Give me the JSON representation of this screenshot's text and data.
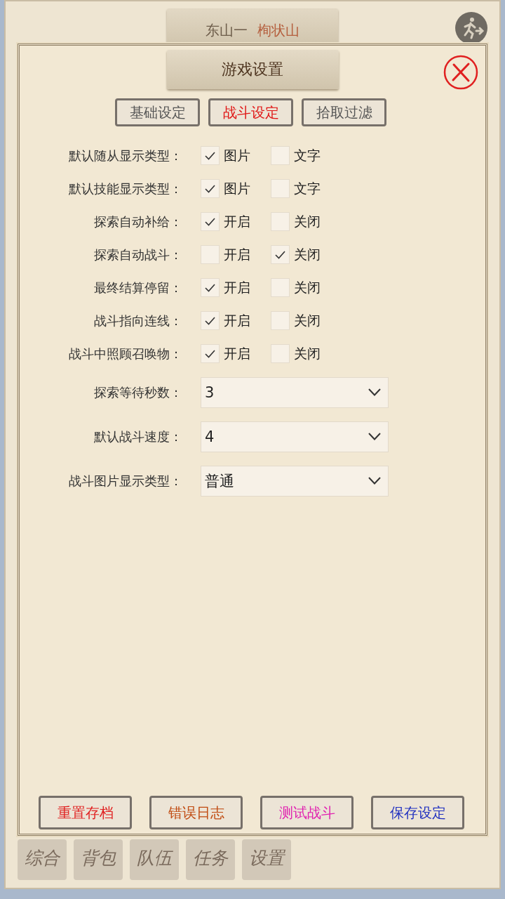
{
  "background": {
    "location": {
      "region": "东山一",
      "place": "栒状山"
    },
    "tabs": [
      {
        "label": "综合"
      },
      {
        "label": "背包"
      },
      {
        "label": "队伍"
      },
      {
        "label": "任务"
      },
      {
        "label": "设置"
      }
    ]
  },
  "dialog": {
    "title": "游戏设置",
    "tabs": [
      {
        "label": "基础设定",
        "selected": false
      },
      {
        "label": "战斗设定",
        "selected": true
      },
      {
        "label": "拾取过滤",
        "selected": false
      }
    ],
    "toggles": [
      {
        "label": "默认随从显示类型：",
        "options": [
          {
            "label": "图片",
            "checked": true
          },
          {
            "label": "文字",
            "checked": false
          }
        ]
      },
      {
        "label": "默认技能显示类型：",
        "options": [
          {
            "label": "图片",
            "checked": true
          },
          {
            "label": "文字",
            "checked": false
          }
        ]
      },
      {
        "label": "探索自动补给：",
        "options": [
          {
            "label": "开启",
            "checked": true
          },
          {
            "label": "关闭",
            "checked": false
          }
        ]
      },
      {
        "label": "探索自动战斗：",
        "options": [
          {
            "label": "开启",
            "checked": false
          },
          {
            "label": "关闭",
            "checked": true
          }
        ]
      },
      {
        "label": "最终结算停留：",
        "options": [
          {
            "label": "开启",
            "checked": true
          },
          {
            "label": "关闭",
            "checked": false
          }
        ]
      },
      {
        "label": "战斗指向连线：",
        "options": [
          {
            "label": "开启",
            "checked": true
          },
          {
            "label": "关闭",
            "checked": false
          }
        ]
      },
      {
        "label": "战斗中照顾召唤物：",
        "options": [
          {
            "label": "开启",
            "checked": true
          },
          {
            "label": "关闭",
            "checked": false
          }
        ]
      }
    ],
    "selects": [
      {
        "label": "探索等待秒数：",
        "value": "3"
      },
      {
        "label": "默认战斗速度：",
        "value": "4"
      },
      {
        "label": "战斗图片显示类型：",
        "value": "普通"
      }
    ],
    "buttons": [
      {
        "label": "重置存档",
        "color": "#e02020"
      },
      {
        "label": "错误日志",
        "color": "#c04a10"
      },
      {
        "label": "测试战斗",
        "color": "#e020b0"
      },
      {
        "label": "保存设定",
        "color": "#2030c0"
      }
    ]
  }
}
